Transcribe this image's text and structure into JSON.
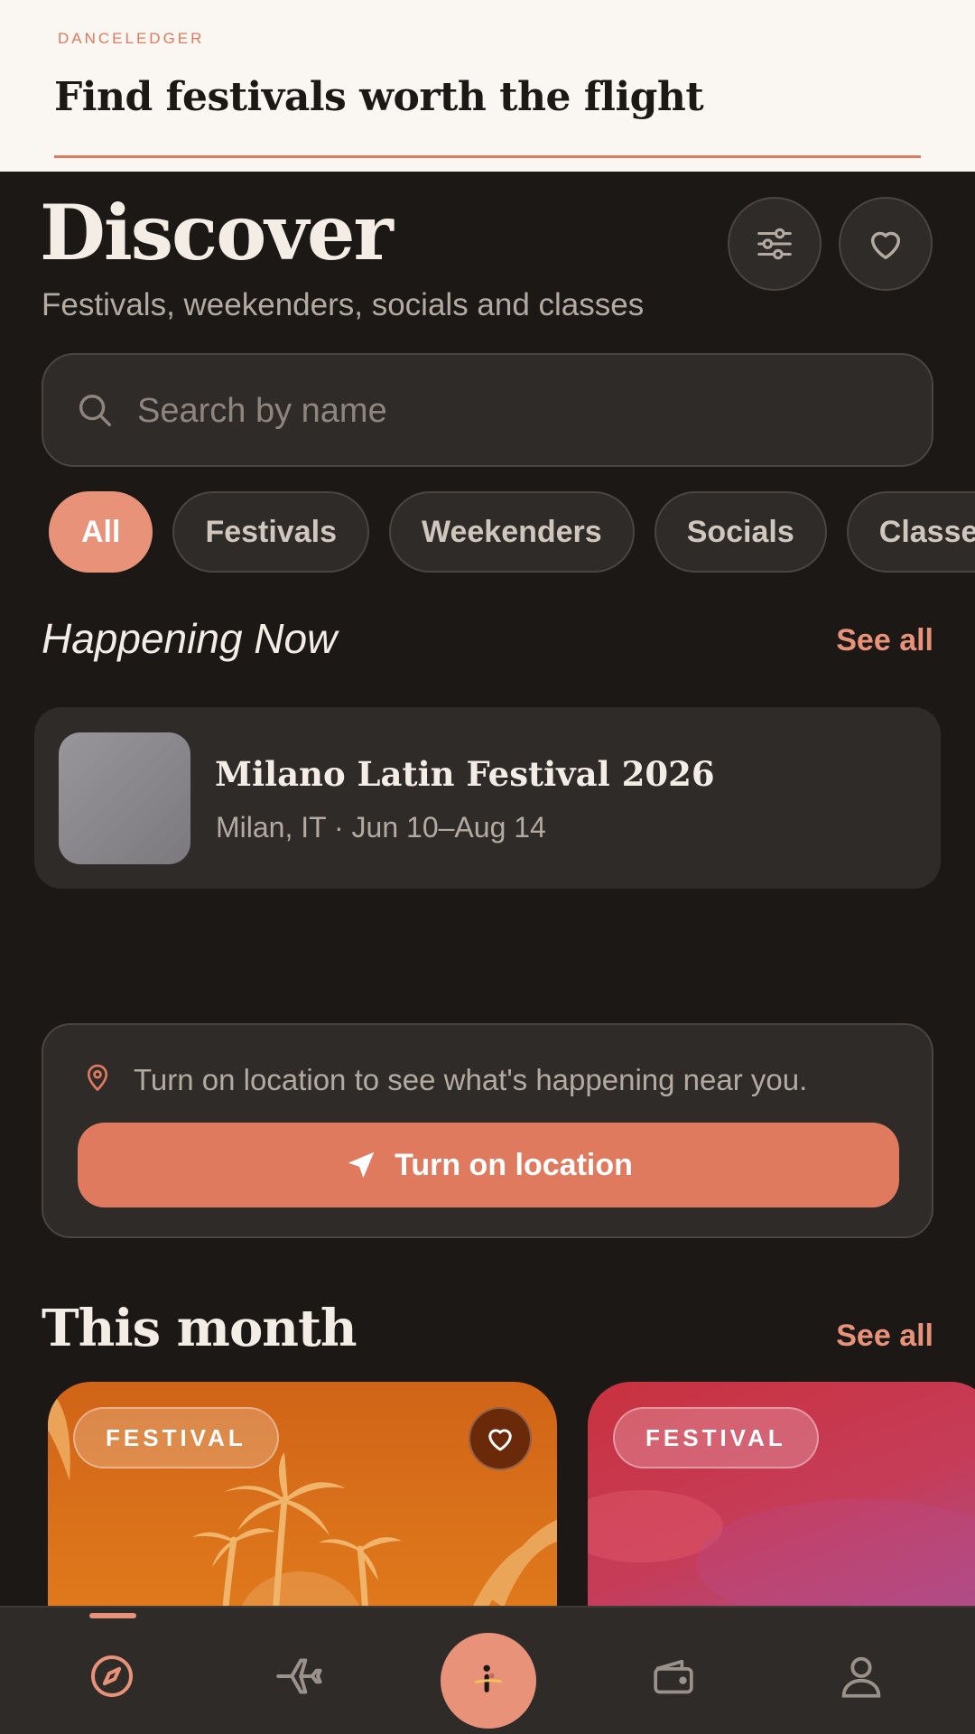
{
  "banner": {
    "brand": "DANCELEDGER",
    "tagline": "Find festivals worth the flight"
  },
  "header": {
    "title": "Discover",
    "subtitle": "Festivals, weekenders, socials and classes"
  },
  "search": {
    "placeholder": "Search by name",
    "value": ""
  },
  "filters": {
    "chips": [
      "All",
      "Festivals",
      "Weekenders",
      "Socials",
      "Classes"
    ],
    "selected": "All"
  },
  "happening_now": {
    "heading": "Happening Now",
    "see_all": "See all",
    "card": {
      "title": "Milano Latin Festival 2026",
      "meta": "Milan, IT · Jun 10–Aug 14"
    }
  },
  "location": {
    "message": "Turn on location to see what's happening near you.",
    "button": "Turn on location"
  },
  "this_month": {
    "heading": "This month",
    "see_all": "See all",
    "cards": [
      {
        "badge": "FESTIVAL"
      },
      {
        "badge": "FESTIVAL"
      }
    ]
  },
  "nav": {
    "items": [
      "compass-icon",
      "plane-icon",
      "dance-icon",
      "wallet-icon",
      "profile-icon"
    ],
    "active": "compass-icon"
  },
  "colors": {
    "accent": "#e07a5f",
    "accent_light": "#e8927a",
    "background": "#1b1816",
    "surface": "#2f2b28",
    "banner": "#faf6f1"
  }
}
